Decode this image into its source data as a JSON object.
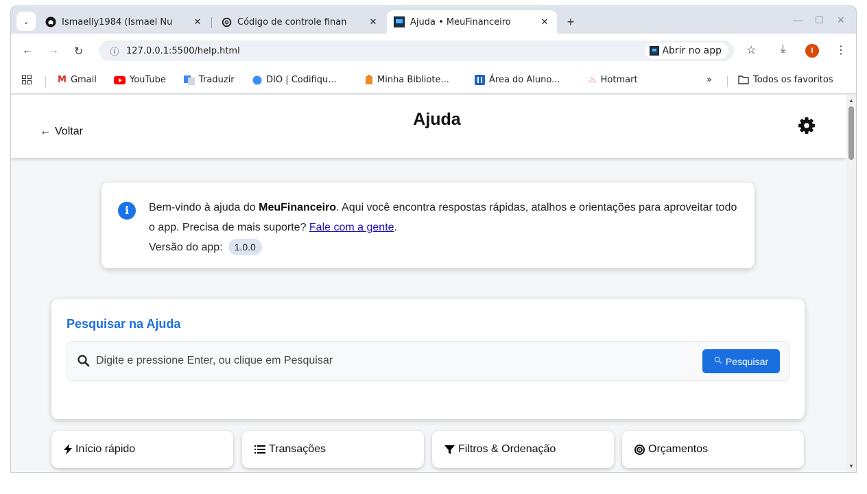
{
  "browser": {
    "tabs": [
      {
        "title": "Ismaelly1984 (Ismael Nu",
        "icon": "github-icon"
      },
      {
        "title": "Código de controle finan",
        "icon": "openai-icon"
      },
      {
        "title": "Ajuda • MeuFinanceiro",
        "icon": "app-icon",
        "active": true
      }
    ],
    "new_tab": "+",
    "url": "127.0.0.1:5500/help.html",
    "open_in_app": "Abrir no app",
    "profile_initial": "I",
    "bookmarks": [
      {
        "label": "Gmail",
        "icon": "gmail-icon"
      },
      {
        "label": "YouTube",
        "icon": "youtube-icon"
      },
      {
        "label": "Traduzir",
        "icon": "translate-icon"
      },
      {
        "label": "DIO | Codifiqu...",
        "icon": "dio-icon"
      },
      {
        "label": "Minha Bibliote...",
        "icon": "library-icon"
      },
      {
        "label": "Área do Aluno...",
        "icon": "student-icon"
      },
      {
        "label": "Hotmart",
        "icon": "hotmart-icon"
      }
    ],
    "more_bookmarks": "»",
    "all_favorites": "Todos os favoritos"
  },
  "header": {
    "back_label": "Voltar",
    "title": "Ajuda"
  },
  "info": {
    "welcome_prefix": "Bem-vindo à ajuda do ",
    "app_name": "MeuFinanceiro",
    "welcome_suffix": ". Aqui você encontra respostas rápidas, atalhos e orientações para aproveitar todo o app. Precisa de mais suporte? ",
    "contact_link": "Fale com a gente",
    "after_link": ".",
    "version_label": "Versão do app:",
    "version": "1.0.0"
  },
  "search": {
    "title": "Pesquisar na Ajuda",
    "placeholder": "Digite e pressione Enter, ou clique em Pesquisar",
    "button_label": "Pesquisar"
  },
  "nav_tiles": [
    {
      "label": "Início rápido",
      "icon": "bolt-icon"
    },
    {
      "label": "Transações",
      "icon": "list-icon"
    },
    {
      "label": "Filtros & Ordenação",
      "icon": "filter-icon"
    },
    {
      "label": "Orçamentos",
      "icon": "target-icon"
    }
  ],
  "colors": {
    "accent": "#1a6fe0",
    "info_icon": "#1a73e8",
    "link": "#1a0dab"
  }
}
